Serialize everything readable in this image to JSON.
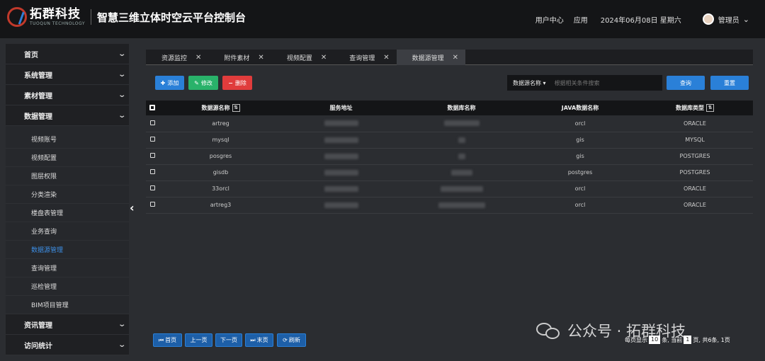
{
  "header": {
    "logo_cn": "拓群科技",
    "logo_en": "TUOQUN TECHNOLOGY",
    "app_title": "智慧三维立体时空云平台控制台",
    "user_center": "用户中心",
    "apps": "应用",
    "date": "2024年06月08日 星期六",
    "user": "管理员"
  },
  "sidebar": {
    "items_top": [
      {
        "label": "首页"
      },
      {
        "label": "系统管理"
      },
      {
        "label": "素材管理"
      },
      {
        "label": "数据管理"
      }
    ],
    "sub_items": [
      {
        "label": "视频账号"
      },
      {
        "label": "视频配置"
      },
      {
        "label": "图层权限"
      },
      {
        "label": "分类渲染"
      },
      {
        "label": "楼盘表管理"
      },
      {
        "label": "业务查询"
      },
      {
        "label": "数据源管理"
      },
      {
        "label": "查询管理"
      },
      {
        "label": "巡检管理"
      },
      {
        "label": "BIM项目管理"
      }
    ],
    "items_bottom": [
      {
        "label": "资讯管理"
      },
      {
        "label": "访问统计"
      }
    ],
    "active_sub": "数据源管理"
  },
  "tabs": [
    {
      "label": "资源监控"
    },
    {
      "label": "附件素材"
    },
    {
      "label": "视频配置"
    },
    {
      "label": "查询管理"
    },
    {
      "label": "数据源管理"
    }
  ],
  "toolbar": {
    "add": "添加",
    "edit": "修改",
    "delete": "删除",
    "search_select": "数据源名称",
    "search_placeholder": "根据相关条件搜索",
    "query": "查询",
    "reset": "重置"
  },
  "table": {
    "headers": [
      "数据源名称",
      "服务地址",
      "数据库名称",
      "JAVA数据名称",
      "数据库类型"
    ],
    "rows": [
      {
        "name": "artreg",
        "java": "orcl",
        "type": "ORACLE"
      },
      {
        "name": "mysql",
        "java": "gis",
        "type": "MYSQL"
      },
      {
        "name": "posgres",
        "java": "gis",
        "type": "POSTGRES"
      },
      {
        "name": "gisdb",
        "java": "postgres",
        "type": "POSTGRES"
      },
      {
        "name": "33orcl",
        "java": "orcl",
        "type": "ORACLE"
      },
      {
        "name": "artreg3",
        "java": "orcl",
        "type": "ORACLE"
      }
    ]
  },
  "pager": {
    "first": "首页",
    "prev": "上一页",
    "next": "下一页",
    "last": "末页",
    "refresh": "刷新",
    "info_prefix": "每页显示",
    "page_size": "10",
    "info_mid": "条, 当前",
    "current": "1",
    "info_suffix": "页, 共6条, 1页"
  },
  "watermark": {
    "text": "公众号 · 拓群科技"
  },
  "colors": {
    "primary": "#2a80d8",
    "success": "#29b26a",
    "danger": "#e03c3c",
    "active_menu": "#3d8fe6"
  }
}
